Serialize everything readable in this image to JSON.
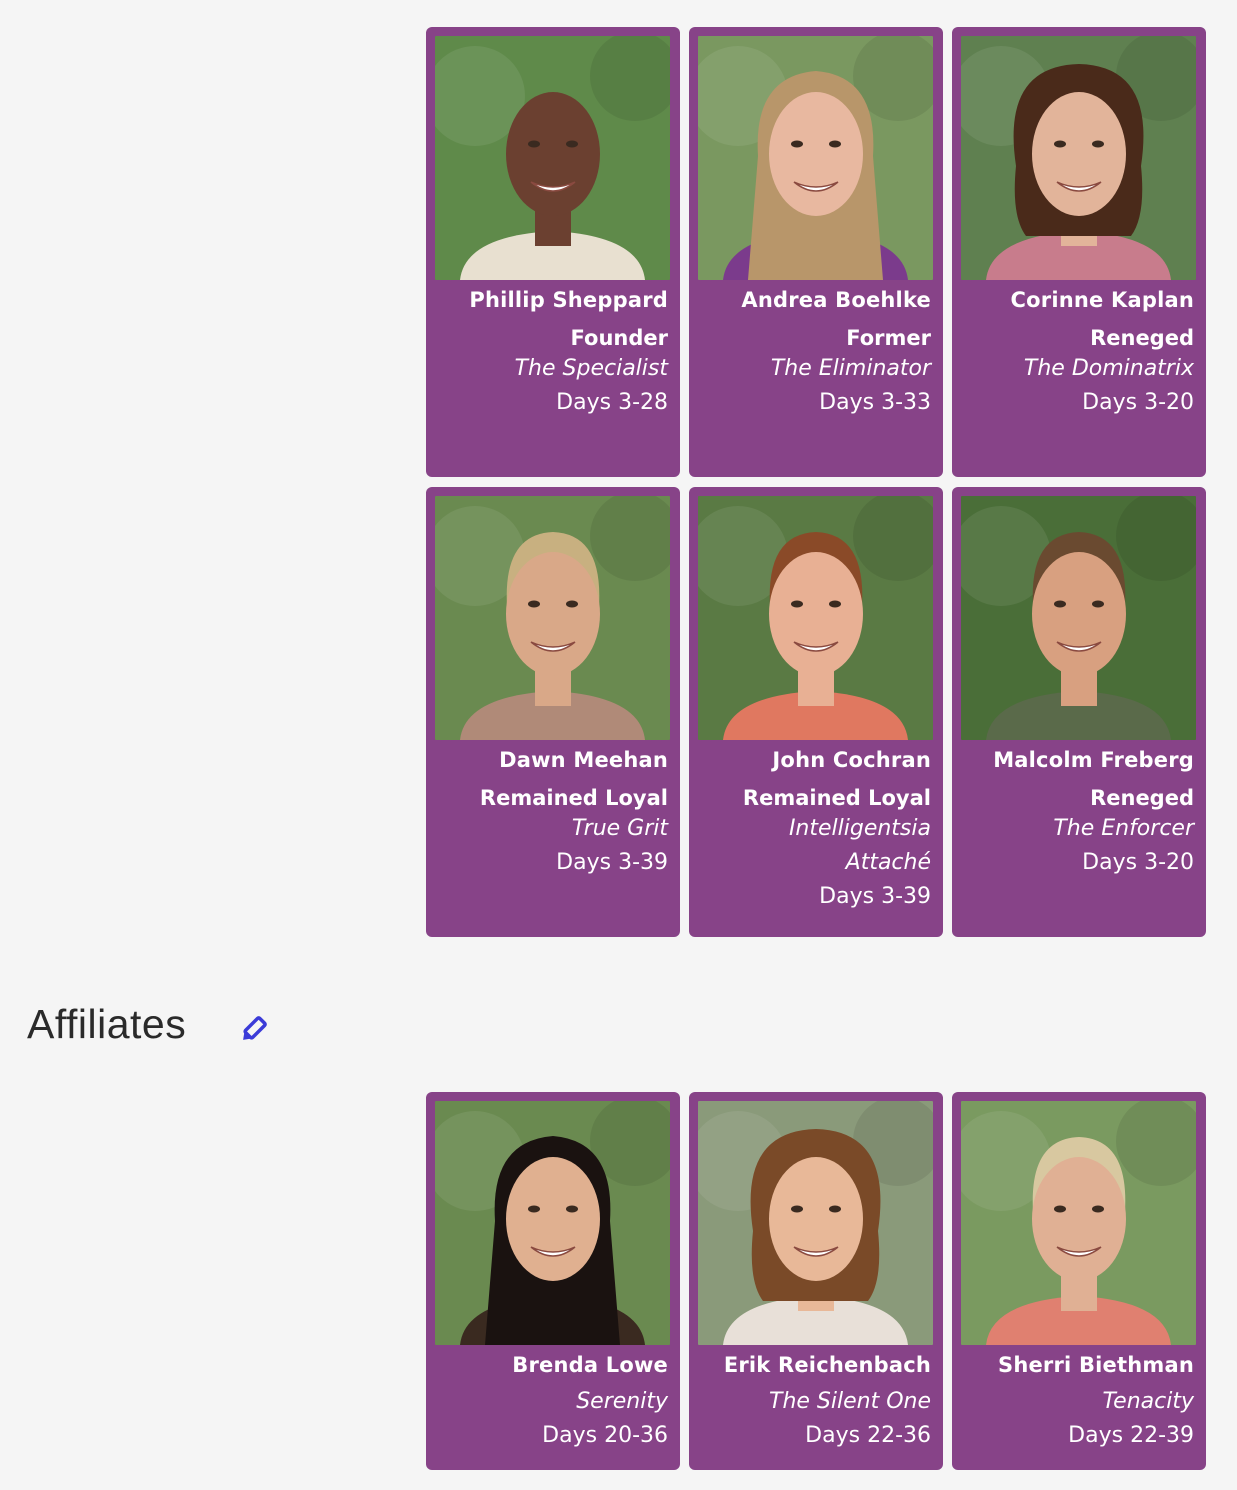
{
  "members": [
    {
      "name": "Phillip Sheppard",
      "status": "Founder",
      "nickname": "The Specialist",
      "nickname2": "",
      "days": "Days 3-28",
      "photo": {
        "bg": "#5f8a4a",
        "skin": "#6b4030",
        "hair": "#2a1a14",
        "shirt": "#e8e0d0",
        "hair_style": "bald"
      }
    },
    {
      "name": "Andrea Boehlke",
      "status": "Former",
      "nickname": "The Eliminator",
      "nickname2": "",
      "days": "Days 3-33",
      "photo": {
        "bg": "#7a9860",
        "skin": "#e8b8a0",
        "hair": "#b8966a",
        "shirt": "#7b3b8c",
        "hair_style": "long"
      }
    },
    {
      "name": "Corinne Kaplan",
      "status": "Reneged",
      "nickname": "The Dominatrix",
      "nickname2": "",
      "days": "Days 3-20",
      "photo": {
        "bg": "#5f8050",
        "skin": "#e2b49a",
        "hair": "#4a2a1a",
        "shirt": "#c87c8c",
        "hair_style": "curly"
      }
    },
    {
      "name": "Dawn Meehan",
      "status": "Remained Loyal",
      "nickname": "True Grit",
      "nickname2": "",
      "days": "Days 3-39",
      "photo": {
        "bg": "#6a8a50",
        "skin": "#d9a888",
        "hair": "#c8b080",
        "shirt": "#b08a78",
        "hair_style": "short"
      }
    },
    {
      "name": "John Cochran",
      "status": "Remained Loyal",
      "nickname": "Intelligentsia",
      "nickname2": "Attaché",
      "days": "Days 3-39",
      "photo": {
        "bg": "#5a7a44",
        "skin": "#e8b094",
        "hair": "#8a4a28",
        "shirt": "#e07860",
        "hair_style": "short"
      }
    },
    {
      "name": "Malcolm Freberg",
      "status": "Reneged",
      "nickname": "The Enforcer",
      "nickname2": "",
      "days": "Days 3-20",
      "photo": {
        "bg": "#4a6e38",
        "skin": "#d8a080",
        "hair": "#6a4a30",
        "shirt": "#5a6a4a",
        "hair_style": "short"
      }
    }
  ],
  "affiliates_heading": "Affiliates",
  "affiliates": [
    {
      "name": "Brenda Lowe",
      "status": "",
      "nickname": "Serenity",
      "nickname2": "",
      "days": "Days 20-36",
      "photo": {
        "bg": "#6a8a50",
        "skin": "#e0b090",
        "hair": "#1a1210",
        "shirt": "#3a2a20",
        "hair_style": "long"
      }
    },
    {
      "name": "Erik Reichenbach",
      "status": "",
      "nickname": "The Silent One",
      "nickname2": "",
      "days": "Days 22-36",
      "photo": {
        "bg": "#8a9a7a",
        "skin": "#e8b898",
        "hair": "#7a4a28",
        "shirt": "#e8e0d8",
        "hair_style": "curly"
      }
    },
    {
      "name": "Sherri Biethman",
      "status": "",
      "nickname": "Tenacity",
      "nickname2": "",
      "days": "Days 22-39",
      "photo": {
        "bg": "#7a9a60",
        "skin": "#e0b094",
        "hair": "#d8c8a0",
        "shirt": "#e08070",
        "hair_style": "short"
      }
    }
  ]
}
